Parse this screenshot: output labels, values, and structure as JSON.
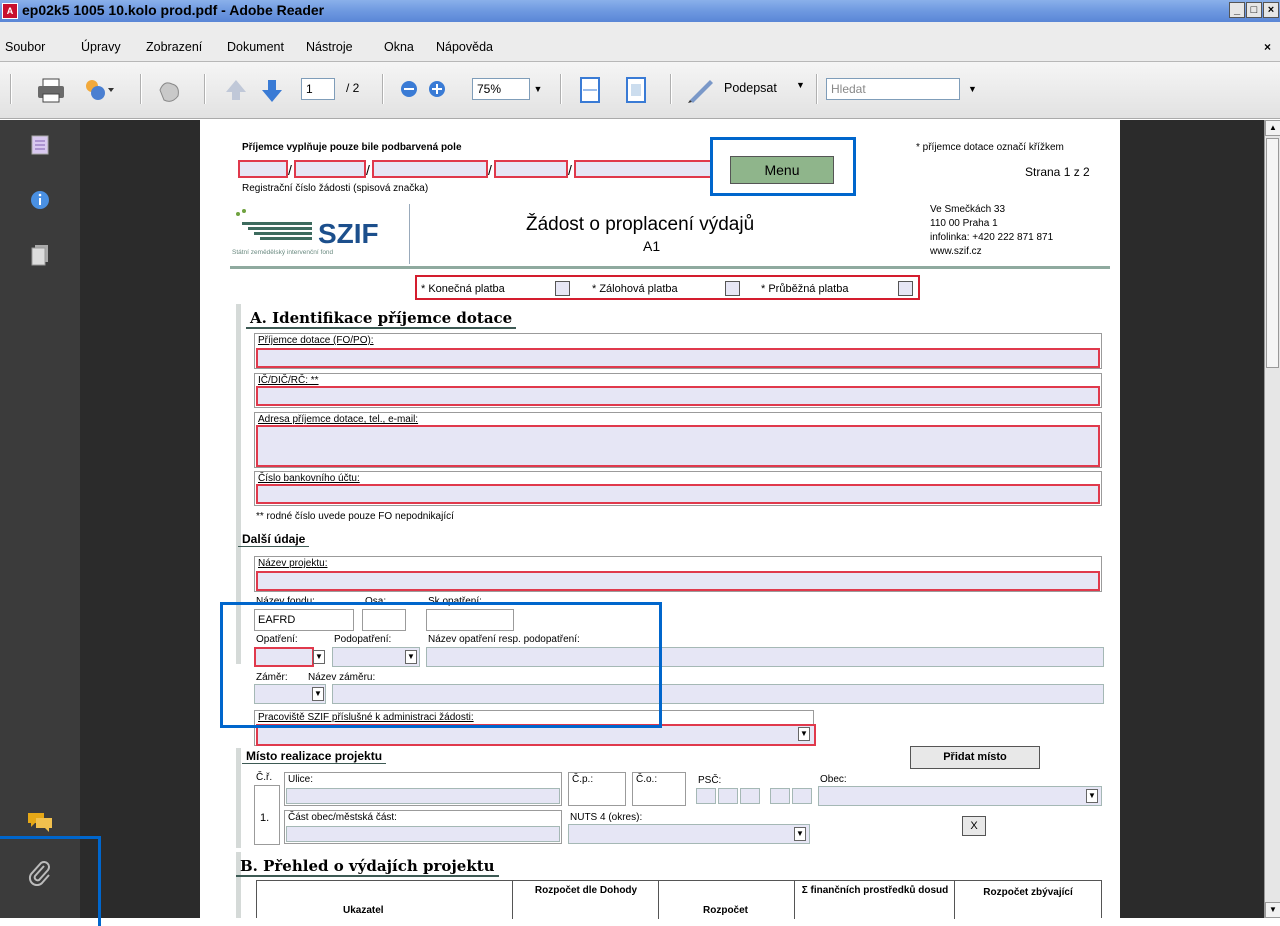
{
  "window": {
    "title": "ep02k5 1005 10.kolo prod.pdf - Adobe Reader",
    "icon": "pdf-app-icon",
    "controls": {
      "minimize": "_",
      "maximize": "□",
      "close": "×"
    }
  },
  "menubar": {
    "items": [
      "Soubor",
      "Úpravy",
      "Zobrazení",
      "Dokument",
      "Nástroje",
      "Okna",
      "Nápověda"
    ],
    "close_glyph": "×"
  },
  "toolbar": {
    "page_current": "1",
    "page_total": "/ 2",
    "zoom": "75%",
    "sign_label": "Podepsat",
    "search_placeholder": "Hledat",
    "icons": [
      "printer-icon",
      "collaborate-icon",
      "hand-icon",
      "arrow-up-icon",
      "arrow-down-icon",
      "zoom-out-icon",
      "zoom-in-icon",
      "fit-width-icon",
      "full-page-icon",
      "pen-icon"
    ]
  },
  "leftnav": {
    "icons": [
      "pages-icon",
      "info-icon",
      "layers-icon",
      "comments-icon",
      "paperclip-icon"
    ]
  },
  "form": {
    "fill_hint": "Příjemce vyplňuje pouze bile podbarvená pole",
    "cross_hint": "* příjemce dotace označí křížkem",
    "page_indicator": "Strana 1 z 2",
    "menu_button": "Menu",
    "reg_label": "Registrační číslo žádosti (spisová značka)",
    "logo_text": "SZIF",
    "logo_subtitle": "Státní zemědělský intervenční fond",
    "title": "Žádost o proplacení výdajů",
    "title_code": "A1",
    "address": [
      "Ve Smečkách 33",
      "110 00 Praha 1",
      "infolinka: +420 222 871 871",
      "www.szif.cz"
    ],
    "payment": {
      "final": "* Konečná platba",
      "advance": "* Zálohová platba",
      "interim": "* Průběžná platba"
    },
    "section_a": "A. Identifikace příjemce dotace",
    "fields_a": {
      "recipient": "Příjemce dotace (FO/PO):",
      "ids": "IČ/DIČ/RČ:  **",
      "address": "Adresa příjemce dotace, tel., e-mail:",
      "bank": "Číslo bankovního účtu:"
    },
    "footnote": "** rodné číslo uvede pouze FO nepodnikající",
    "further_title": "Další údaje",
    "project_name": "Název projektu:",
    "fund_name": "Název fondu:",
    "axis": "Osa:",
    "measure_group": "Sk.opatření:",
    "fund_value": "EAFRD",
    "measure": "Opatření:",
    "submeasure": "Podopatření:",
    "measure_name": "Název opatření resp. podopatření:",
    "intent": "Záměr:",
    "intent_name": "Název záměru:",
    "office": "Pracoviště SZIF příslušné k administraci žádosti:",
    "location_title": "Místo realizace projektu",
    "add_location": "Přidat místo",
    "loc": {
      "no_label": "Č.ř.",
      "no": "1.",
      "street": "Ulice:",
      "cp": "Č.p.:",
      "co": "Č.o.:",
      "psc": "PSČ:",
      "municipality": "Obec:",
      "part": "Část obec/městská část:",
      "nuts": "NUTS 4 (okres):",
      "remove": "X"
    },
    "section_b": "B. Přehled o výdajích projektu",
    "table_headers": [
      "Ukazatel",
      "Rozpočet dle Dohody",
      "Rozpočet",
      "Σ finančních prostředků dosud",
      "Rozpočet zbývající"
    ]
  },
  "colors": {
    "required_border": "#e0394c",
    "field_fill": "#e6e6f5",
    "highlight": "#0066cc",
    "section_green": "#3d5a54"
  }
}
